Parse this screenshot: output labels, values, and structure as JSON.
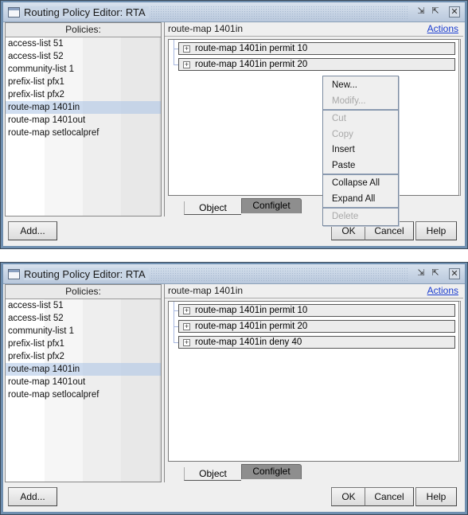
{
  "windows": [
    {
      "title": "Routing Policy Editor: RTA",
      "policies_header": "Policies:",
      "policies": [
        {
          "label": "access-list 51",
          "selected": false
        },
        {
          "label": "access-list 52",
          "selected": false
        },
        {
          "label": "community-list 1",
          "selected": false
        },
        {
          "label": "prefix-list pfx1",
          "selected": false
        },
        {
          "label": "prefix-list pfx2",
          "selected": false
        },
        {
          "label": "route-map 1401in",
          "selected": true
        },
        {
          "label": "route-map 1401out",
          "selected": false
        },
        {
          "label": "route-map setlocalpref",
          "selected": false
        }
      ],
      "detail_title": "route-map 1401in",
      "actions_link": "Actions",
      "tree_nodes": [
        {
          "label": "route-map 1401in permit 10",
          "expander": "+"
        },
        {
          "label": "route-map 1401in permit 20",
          "expander": "+"
        }
      ],
      "tabs": {
        "object": "Object",
        "configlet": "Configlet"
      },
      "buttons": {
        "add": "Add...",
        "ok": "OK",
        "cancel": "Cancel",
        "help": "Help"
      },
      "context_menu": {
        "groups": [
          [
            {
              "label": "New...",
              "enabled": true
            },
            {
              "label": "Modify...",
              "enabled": false
            }
          ],
          [
            {
              "label": "Cut",
              "enabled": false
            },
            {
              "label": "Copy",
              "enabled": false
            },
            {
              "label": "Insert",
              "enabled": true
            },
            {
              "label": "Paste",
              "enabled": true
            }
          ],
          [
            {
              "label": "Collapse All",
              "enabled": true
            },
            {
              "label": "Expand All",
              "enabled": true
            }
          ],
          [
            {
              "label": "Delete",
              "enabled": false
            }
          ]
        ]
      }
    },
    {
      "title": "Routing Policy Editor: RTA",
      "policies_header": "Policies:",
      "policies": [
        {
          "label": "access-list 51",
          "selected": false
        },
        {
          "label": "access-list 52",
          "selected": false
        },
        {
          "label": "community-list 1",
          "selected": false
        },
        {
          "label": "prefix-list pfx1",
          "selected": false
        },
        {
          "label": "prefix-list pfx2",
          "selected": false
        },
        {
          "label": "route-map 1401in",
          "selected": true
        },
        {
          "label": "route-map 1401out",
          "selected": false
        },
        {
          "label": "route-map setlocalpref",
          "selected": false
        }
      ],
      "detail_title": "route-map 1401in",
      "actions_link": "Actions",
      "tree_nodes": [
        {
          "label": "route-map 1401in permit 10",
          "expander": "+"
        },
        {
          "label": "route-map 1401in permit 20",
          "expander": "+"
        },
        {
          "label": "route-map 1401in deny 40",
          "expander": "+"
        }
      ],
      "tabs": {
        "object": "Object",
        "configlet": "Configlet"
      },
      "buttons": {
        "add": "Add...",
        "ok": "OK",
        "cancel": "Cancel",
        "help": "Help"
      }
    }
  ],
  "icons": {
    "window_icon": "window-icon",
    "restore": "⇲",
    "maximize": "⇱",
    "close": "✕"
  }
}
